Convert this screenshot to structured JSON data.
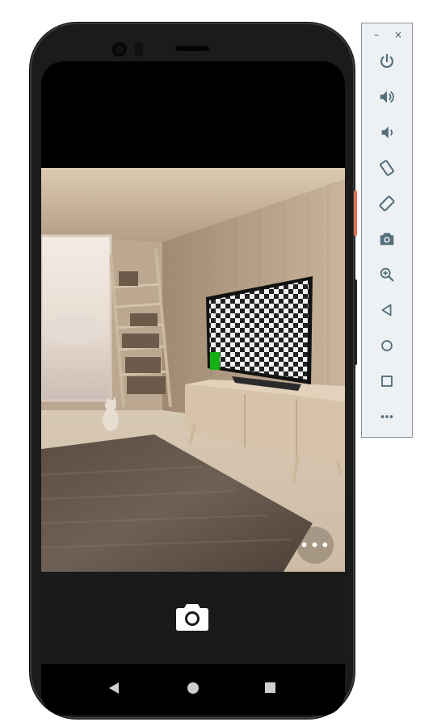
{
  "toolbar": {
    "window_controls": [
      {
        "name": "minimize",
        "glyph": "–"
      },
      {
        "name": "close",
        "glyph": "×"
      }
    ],
    "buttons": [
      {
        "name": "power-icon"
      },
      {
        "name": "volume-up-icon"
      },
      {
        "name": "volume-down-icon"
      },
      {
        "name": "rotate-left-icon"
      },
      {
        "name": "rotate-right-icon"
      },
      {
        "name": "screenshot-icon"
      },
      {
        "name": "zoom-icon"
      },
      {
        "name": "back-icon"
      },
      {
        "name": "home-icon"
      },
      {
        "name": "overview-icon"
      },
      {
        "name": "more-icon"
      }
    ],
    "icon_color": "#546e7a"
  },
  "camera_app": {
    "more_button_label": "•••",
    "shutter_icon": "camera-icon",
    "bottom_bar_color": "#1a1a1a"
  },
  "nav_bar": {
    "buttons": [
      "back",
      "home",
      "recents"
    ]
  }
}
